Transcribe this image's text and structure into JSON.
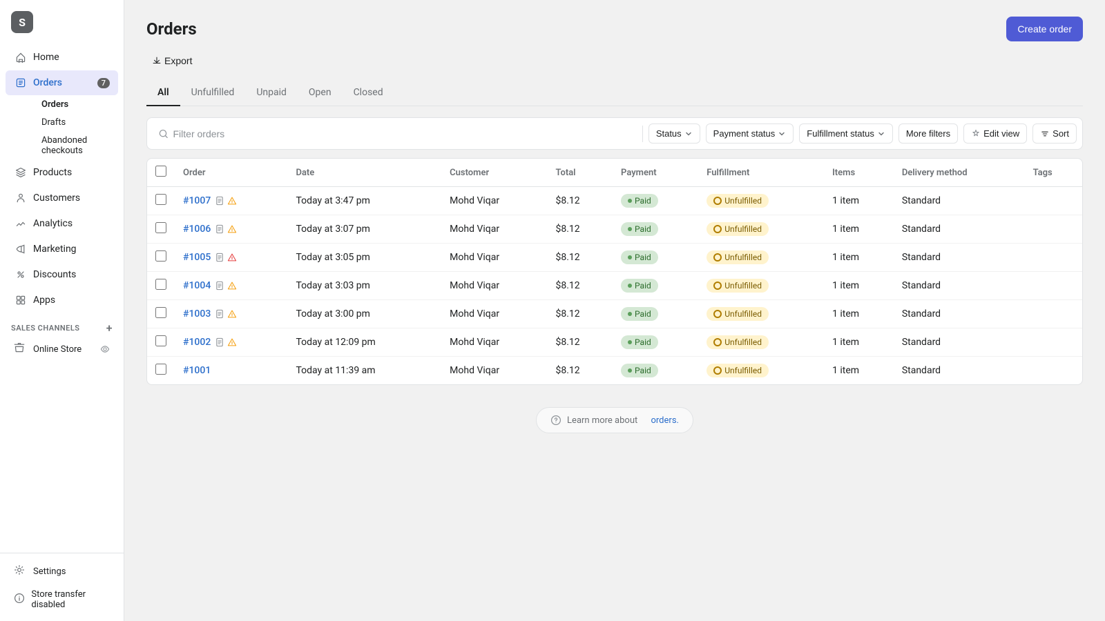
{
  "sidebar": {
    "logo": "S",
    "nav_items": [
      {
        "id": "home",
        "label": "Home",
        "icon": "home-icon",
        "badge": null,
        "active": false
      },
      {
        "id": "orders",
        "label": "Orders",
        "icon": "orders-icon",
        "badge": "7",
        "active": true
      },
      {
        "id": "products",
        "label": "Products",
        "icon": "products-icon",
        "badge": null,
        "active": false
      },
      {
        "id": "customers",
        "label": "Customers",
        "icon": "customers-icon",
        "badge": null,
        "active": false
      },
      {
        "id": "analytics",
        "label": "Analytics",
        "icon": "analytics-icon",
        "badge": null,
        "active": false
      },
      {
        "id": "marketing",
        "label": "Marketing",
        "icon": "marketing-icon",
        "badge": null,
        "active": false
      },
      {
        "id": "discounts",
        "label": "Discounts",
        "icon": "discounts-icon",
        "badge": null,
        "active": false
      },
      {
        "id": "apps",
        "label": "Apps",
        "icon": "apps-icon",
        "badge": null,
        "active": false
      }
    ],
    "order_subitems": [
      {
        "id": "orders-sub",
        "label": "Orders",
        "active": true
      },
      {
        "id": "drafts",
        "label": "Drafts",
        "active": false
      },
      {
        "id": "abandoned-checkouts",
        "label": "Abandoned checkouts",
        "active": false
      }
    ],
    "sales_channels_label": "SALES CHANNELS",
    "sales_channels": [
      {
        "id": "online-store",
        "label": "Online Store"
      }
    ],
    "bottom_items": [
      {
        "id": "settings",
        "label": "Settings",
        "icon": "settings-icon"
      },
      {
        "id": "store-transfer",
        "label": "Store transfer disabled",
        "icon": "info-icon"
      }
    ]
  },
  "header": {
    "title": "Orders",
    "create_button": "Create order"
  },
  "export": {
    "label": "Export"
  },
  "tabs": [
    {
      "id": "all",
      "label": "All",
      "active": true
    },
    {
      "id": "unfulfilled",
      "label": "Unfulfilled",
      "active": false
    },
    {
      "id": "unpaid",
      "label": "Unpaid",
      "active": false
    },
    {
      "id": "open",
      "label": "Open",
      "active": false
    },
    {
      "id": "closed",
      "label": "Closed",
      "active": false
    }
  ],
  "filters": {
    "search_placeholder": "Filter orders",
    "status_label": "Status",
    "payment_status_label": "Payment status",
    "fulfillment_status_label": "Fulfillment status",
    "more_filters_label": "More filters",
    "edit_view_label": "Edit view",
    "sort_label": "Sort"
  },
  "table": {
    "columns": [
      "",
      "Order",
      "Date",
      "Customer",
      "Total",
      "Payment",
      "Fulfillment",
      "Items",
      "Delivery method",
      "Tags"
    ],
    "rows": [
      {
        "id": "#1007",
        "date": "Today at 3:47 pm",
        "customer": "Mohd Viqar",
        "total": "$8.12",
        "payment": "Paid",
        "fulfillment": "Unfulfilled",
        "items": "1 item",
        "delivery": "Standard",
        "has_note": true,
        "has_warn": true,
        "warn_color": "yellow"
      },
      {
        "id": "#1006",
        "date": "Today at 3:07 pm",
        "customer": "Mohd Viqar",
        "total": "$8.12",
        "payment": "Paid",
        "fulfillment": "Unfulfilled",
        "items": "1 item",
        "delivery": "Standard",
        "has_note": true,
        "has_warn": true,
        "warn_color": "yellow"
      },
      {
        "id": "#1005",
        "date": "Today at 3:05 pm",
        "customer": "Mohd Viqar",
        "total": "$8.12",
        "payment": "Paid",
        "fulfillment": "Unfulfilled",
        "items": "1 item",
        "delivery": "Standard",
        "has_note": true,
        "has_warn": true,
        "warn_color": "red"
      },
      {
        "id": "#1004",
        "date": "Today at 3:03 pm",
        "customer": "Mohd Viqar",
        "total": "$8.12",
        "payment": "Paid",
        "fulfillment": "Unfulfilled",
        "items": "1 item",
        "delivery": "Standard",
        "has_note": true,
        "has_warn": true,
        "warn_color": "yellow"
      },
      {
        "id": "#1003",
        "date": "Today at 3:00 pm",
        "customer": "Mohd Viqar",
        "total": "$8.12",
        "payment": "Paid",
        "fulfillment": "Unfulfilled",
        "items": "1 item",
        "delivery": "Standard",
        "has_note": true,
        "has_warn": true,
        "warn_color": "yellow"
      },
      {
        "id": "#1002",
        "date": "Today at 12:09 pm",
        "customer": "Mohd Viqar",
        "total": "$8.12",
        "payment": "Paid",
        "fulfillment": "Unfulfilled",
        "items": "1 item",
        "delivery": "Standard",
        "has_note": true,
        "has_warn": true,
        "warn_color": "yellow"
      },
      {
        "id": "#1001",
        "date": "Today at 11:39 am",
        "customer": "Mohd Viqar",
        "total": "$8.12",
        "payment": "Paid",
        "fulfillment": "Unfulfilled",
        "items": "1 item",
        "delivery": "Standard",
        "has_note": false,
        "has_warn": false,
        "warn_color": null
      }
    ]
  },
  "learn_more": {
    "text": "Learn more about",
    "link_text": "orders.",
    "link_href": "#"
  }
}
